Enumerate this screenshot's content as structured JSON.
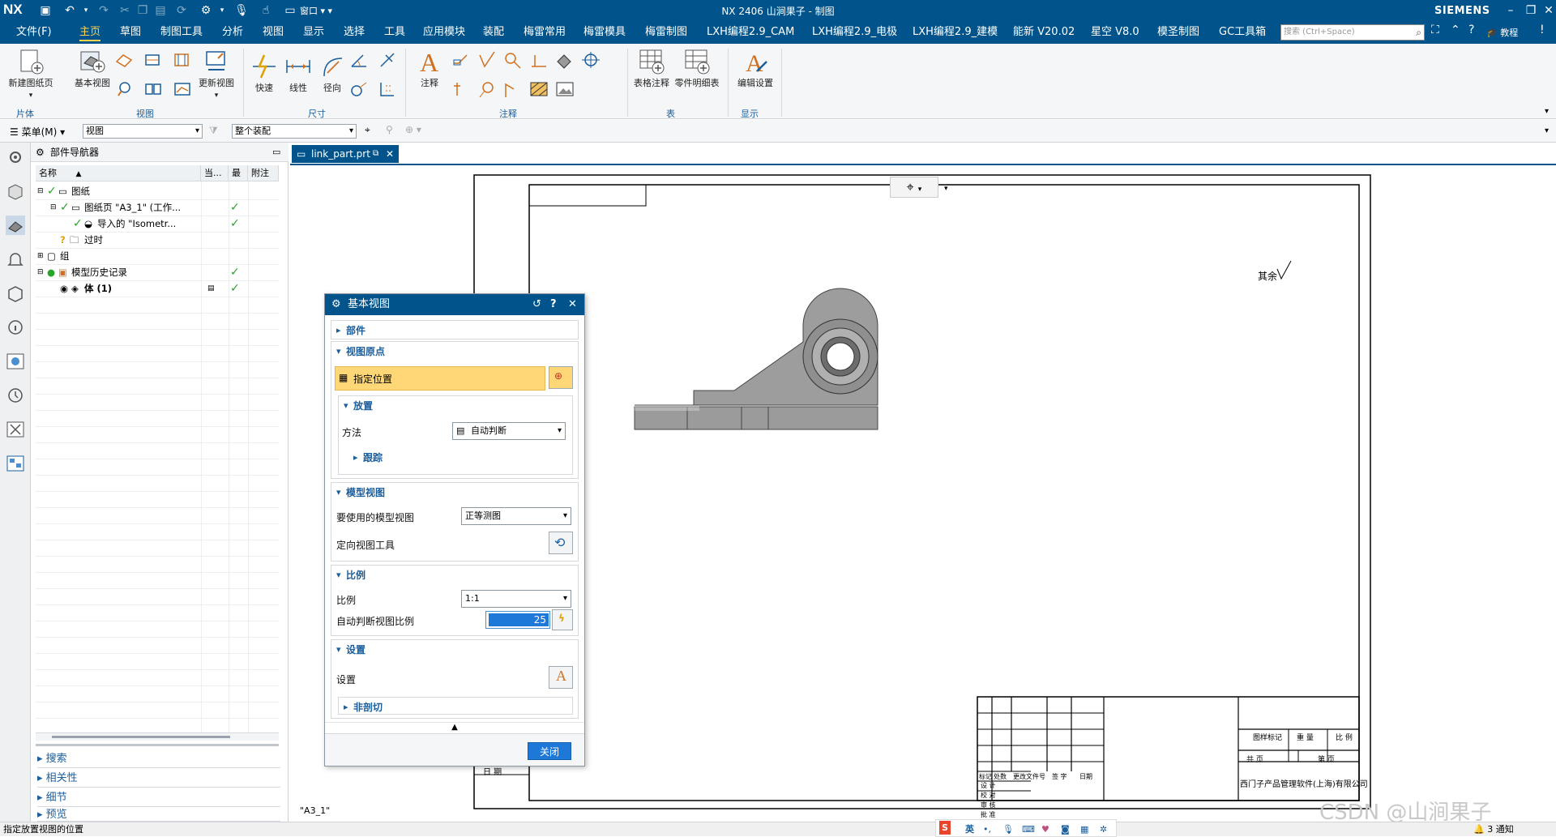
{
  "app": {
    "logo": "NX",
    "title": "NX 2406 山涧果子 - 制图",
    "brand": "SIEMENS"
  },
  "menubar": {
    "file": "文件(F)",
    "tabs": [
      "主页",
      "草图",
      "制图工具",
      "分析",
      "视图",
      "显示",
      "选择",
      "工具",
      "应用模块",
      "装配",
      "梅雷常用",
      "梅雷模具",
      "梅雷制图",
      "LXH编程2.9_CAM",
      "LXH编程2.9_电极",
      "LXH编程2.9_建模",
      "能新 V20.02",
      "星空 V8.0",
      "模圣制图",
      "GC工具箱"
    ],
    "active_index": 0,
    "search_placeholder": "搜索 (Ctrl+Space)",
    "tutorial": "教程"
  },
  "ribbon": {
    "new_sheet": "新建图纸页",
    "base_view": "基本视图",
    "update_view": "更新视图",
    "rapid": "快速",
    "linear": "线性",
    "radial": "径向",
    "note": "注释",
    "table_note": "表格注释",
    "parts_list": "零件明细表",
    "edit_settings": "编辑设置",
    "groups": [
      "片体",
      "视图",
      "尺寸",
      "注释",
      "表",
      "显示"
    ]
  },
  "toolbar2": {
    "menu": "菜单(M)",
    "filter": "视图",
    "scope": "整个装配"
  },
  "navigator": {
    "title": "部件导航器",
    "columns": [
      "名称",
      "当...",
      "最",
      "附注"
    ],
    "rows": [
      {
        "label": "图纸",
        "check": false
      },
      {
        "label": "图纸页 \"A3_1\" (工作...",
        "check": true
      },
      {
        "label": "导入的 \"Isometr...",
        "check": true
      },
      {
        "label": "过时",
        "check": false
      },
      {
        "label": "组",
        "check": false
      },
      {
        "label": "模型历史记录",
        "check": true
      },
      {
        "label": "体 (1)",
        "check": true
      }
    ],
    "sections": [
      "搜索",
      "相关性",
      "细节",
      "预览"
    ]
  },
  "document": {
    "tab": "link_part.prt",
    "sheet_label": "\"A3_1\""
  },
  "dialog": {
    "title": "基本视图",
    "part": "部件",
    "view_origin": "视图原点",
    "specify_location": "指定位置",
    "placement": "放置",
    "method_label": "方法",
    "method_value": "自动判断",
    "track": "跟踪",
    "model_view": "模型视图",
    "model_view_label": "要使用的模型视图",
    "model_view_value": "正等测图",
    "orient_tool": "定向视图工具",
    "scale": "比例",
    "scale_label": "比例",
    "scale_value": "1:1",
    "auto_scale_label": "自动判断视图比例",
    "auto_scale_value": "25",
    "settings": "设置",
    "settings_label": "设置",
    "non_section": "非剖切",
    "close": "关闭"
  },
  "drawing": {
    "roughness_text": "其余",
    "titleblock": {
      "mark": "标记",
      "count": "处数",
      "change_doc": "更改文件号",
      "sign": "签 字",
      "date": "日期",
      "design": "设 计",
      "check": "校 对",
      "review": "审 核",
      "approve": "批 准",
      "stage_mark": "图样标记",
      "weight": "重 量",
      "ratio": "比 例",
      "total_pages": "共   页",
      "page": "第   页",
      "company": "西门子产品管理软件(上海)有限公司",
      "date_cell": "日  期"
    }
  },
  "status": {
    "message": "指定放置视图的位置",
    "watermark": "CSDN @山涧果子",
    "ime_lang": "英",
    "notify": "3 通知"
  }
}
